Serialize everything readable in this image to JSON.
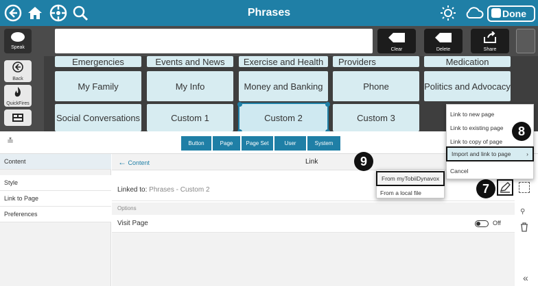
{
  "titlebar": {
    "title": "Phrases",
    "done_label": "Done"
  },
  "msgbar": {
    "speak_label": "Speak",
    "clear_label": "Clear",
    "delete_label": "Delete",
    "share_label": "Share"
  },
  "leftnav": {
    "back_label": "Back",
    "quickfires_label": "QuickFires"
  },
  "grid": {
    "row1": [
      "Emergencies",
      "Events and News",
      "Exercise and Health",
      "Providers",
      "Medication"
    ],
    "row2": [
      "My Family",
      "My Info",
      "Money and Banking",
      "Phone",
      "Politics and Advocacy"
    ],
    "row3": [
      "Social Conversations",
      "Custom 1",
      "Custom 2",
      "Custom 3"
    ]
  },
  "tabs": [
    "Button",
    "Page",
    "Page Set",
    "User",
    "System"
  ],
  "sidebar": [
    "Content",
    "Style",
    "Link to Page",
    "Preferences"
  ],
  "panel": {
    "back_label": "Content",
    "title": "Link",
    "linked_label": "Linked to:",
    "linked_value": "Phrases - Custom 2",
    "options_label": "Options",
    "visit_label": "Visit Page",
    "toggle_label": "Off"
  },
  "menu": {
    "items": [
      "Link to new page",
      "Link to existing page",
      "Link to copy of page",
      "Import and link to page",
      "Cancel"
    ],
    "sub_items": [
      "From myTobiiDynavox",
      "From a local file"
    ]
  },
  "callouts": [
    "7",
    "8",
    "9"
  ]
}
